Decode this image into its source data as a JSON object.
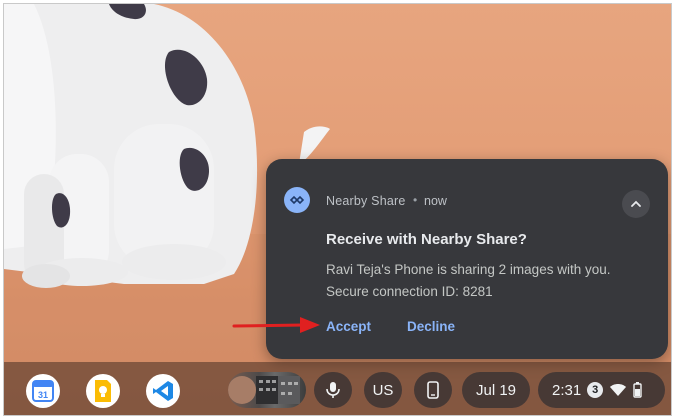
{
  "notification": {
    "app_name": "Nearby Share",
    "separator": "•",
    "time": "now",
    "title": "Receive with Nearby Share?",
    "message_line1": "Ravi Teja's Phone is sharing 2 images with you.",
    "message_line2": "Secure connection ID: 8281",
    "accept_label": "Accept",
    "decline_label": "Decline",
    "accent_color": "#8ab4f8"
  },
  "shelf": {
    "calendar_day": "31",
    "input_method": "US",
    "date": "Jul 19",
    "time": "2:31",
    "notification_count": "3"
  },
  "annotation": {
    "arrow_color": "#e02020"
  }
}
